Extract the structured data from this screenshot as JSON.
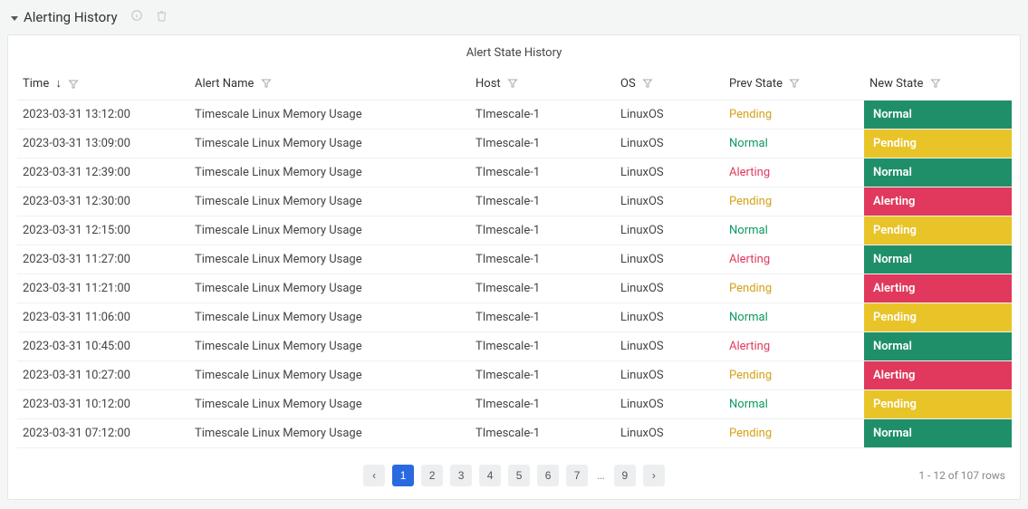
{
  "panel": {
    "title": "Alerting History"
  },
  "card": {
    "title": "Alert State History"
  },
  "columns": {
    "time": "Time",
    "alert_name": "Alert Name",
    "host": "Host",
    "os": "OS",
    "prev_state": "Prev State",
    "new_state": "New State"
  },
  "chart_data": {
    "type": "table",
    "columns": [
      "Time",
      "Alert Name",
      "Host",
      "OS",
      "Prev State",
      "New State"
    ],
    "rows": [
      {
        "time": "2023-03-31 13:12:00",
        "alert_name": "Timescale Linux Memory Usage",
        "host": "TImescale-1",
        "os": "LinuxOS",
        "prev_state": "Pending",
        "new_state": "Normal"
      },
      {
        "time": "2023-03-31 13:09:00",
        "alert_name": "Timescale Linux Memory Usage",
        "host": "TImescale-1",
        "os": "LinuxOS",
        "prev_state": "Normal",
        "new_state": "Pending"
      },
      {
        "time": "2023-03-31 12:39:00",
        "alert_name": "Timescale Linux Memory Usage",
        "host": "TImescale-1",
        "os": "LinuxOS",
        "prev_state": "Alerting",
        "new_state": "Normal"
      },
      {
        "time": "2023-03-31 12:30:00",
        "alert_name": "Timescale Linux Memory Usage",
        "host": "TImescale-1",
        "os": "LinuxOS",
        "prev_state": "Pending",
        "new_state": "Alerting"
      },
      {
        "time": "2023-03-31 12:15:00",
        "alert_name": "Timescale Linux Memory Usage",
        "host": "TImescale-1",
        "os": "LinuxOS",
        "prev_state": "Normal",
        "new_state": "Pending"
      },
      {
        "time": "2023-03-31 11:27:00",
        "alert_name": "Timescale Linux Memory Usage",
        "host": "TImescale-1",
        "os": "LinuxOS",
        "prev_state": "Alerting",
        "new_state": "Normal"
      },
      {
        "time": "2023-03-31 11:21:00",
        "alert_name": "Timescale Linux Memory Usage",
        "host": "TImescale-1",
        "os": "LinuxOS",
        "prev_state": "Pending",
        "new_state": "Alerting"
      },
      {
        "time": "2023-03-31 11:06:00",
        "alert_name": "Timescale Linux Memory Usage",
        "host": "TImescale-1",
        "os": "LinuxOS",
        "prev_state": "Normal",
        "new_state": "Pending"
      },
      {
        "time": "2023-03-31 10:45:00",
        "alert_name": "Timescale Linux Memory Usage",
        "host": "TImescale-1",
        "os": "LinuxOS",
        "prev_state": "Alerting",
        "new_state": "Normal"
      },
      {
        "time": "2023-03-31 10:27:00",
        "alert_name": "Timescale Linux Memory Usage",
        "host": "TImescale-1",
        "os": "LinuxOS",
        "prev_state": "Pending",
        "new_state": "Alerting"
      },
      {
        "time": "2023-03-31 10:12:00",
        "alert_name": "Timescale Linux Memory Usage",
        "host": "TImescale-1",
        "os": "LinuxOS",
        "prev_state": "Normal",
        "new_state": "Pending"
      },
      {
        "time": "2023-03-31 07:12:00",
        "alert_name": "Timescale Linux Memory Usage",
        "host": "TImescale-1",
        "os": "LinuxOS",
        "prev_state": "Pending",
        "new_state": "Normal"
      }
    ]
  },
  "pagination": {
    "prev_glyph": "‹",
    "next_glyph": "›",
    "pages": [
      "1",
      "2",
      "3",
      "4",
      "5",
      "6",
      "7",
      "…",
      "9"
    ],
    "current": "1",
    "summary": "1 - 12 of 107 rows"
  },
  "icons": {
    "sort_desc": "↓"
  }
}
